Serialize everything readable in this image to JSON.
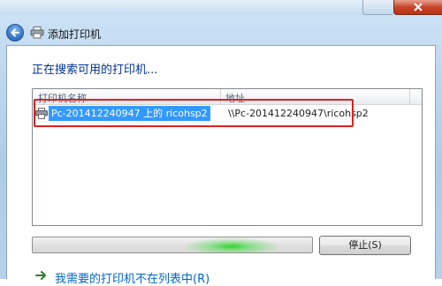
{
  "window": {
    "title": "添加打印机"
  },
  "main": {
    "heading": "正在搜索可用的打印机...",
    "columns": {
      "name": "打印机名称",
      "address": "地址"
    },
    "rows": [
      {
        "name": "Pc-201412240947 上的 ricohsp2",
        "address": "\\\\Pc-201412240947\\ricohsp2",
        "selected": true
      }
    ],
    "progress": {
      "state": "indeterminate"
    },
    "stop_button": "停止(S)",
    "not_listed_link": "我需要的打印机不在列表中(R)"
  },
  "colors": {
    "selection": "#3399ff",
    "heading": "#003399",
    "highlight_box": "#e02020",
    "progress_glow": "#28d228"
  },
  "icons": [
    "close-icon",
    "back-arrow-icon",
    "printer-icon",
    "link-arrow-icon"
  ]
}
